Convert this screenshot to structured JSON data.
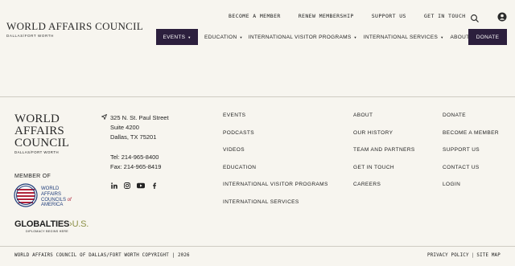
{
  "header": {
    "logo_main": "WORLD AFFAIRS COUNCIL",
    "logo_sub": "DALLAS/FORT WORTH",
    "top_links": [
      "BECOME A MEMBER",
      "RENEW MEMBERSHIP",
      "SUPPORT US",
      "GET IN TOUCH"
    ],
    "search_icon": "search-icon",
    "user_icon": "user-icon",
    "main_nav": {
      "events": "EVENTS",
      "education": "EDUCATION",
      "ivp": "INTERNATIONAL VISITOR PROGRAMS",
      "services": "INTERNATIONAL SERVICES",
      "about": "ABOUT",
      "donate": "DONATE"
    },
    "accent_color": "#2c1f3d"
  },
  "footer": {
    "logo_lines": [
      "WORLD",
      "AFFAIRS",
      "COUNCIL"
    ],
    "logo_sub": "DALLAS/FORT WORTH",
    "member_of": "MEMBER OF",
    "wacca_lines": [
      "WORLD",
      "AFFAIRS",
      "COUNCILS",
      "of",
      "AMERICA"
    ],
    "globalties": {
      "global": "GLOBAL",
      "ties": "TIES",
      "us": "U.S.",
      "tagline": "DIPLOMACY BEGINS HERE"
    },
    "contact": {
      "address_lines": [
        "325 N. St. Paul Street",
        "Suite 4200",
        "Dallas, TX 75201"
      ],
      "tel": "Tel: 214-965-8400",
      "fax": "Fax: 214-965-8419"
    },
    "socials": [
      "linkedin-icon",
      "instagram-icon",
      "youtube-icon",
      "facebook-icon"
    ],
    "col1": [
      "EVENTS",
      "PODCASTS",
      "VIDEOS",
      "EDUCATION",
      "INTERNATIONAL VISITOR PROGRAMS",
      "INTERNATIONAL SERVICES"
    ],
    "col2": [
      "ABOUT",
      "OUR HISTORY",
      "TEAM AND PARTNERS",
      "GET IN TOUCH",
      "CAREERS"
    ],
    "col3": [
      "DONATE",
      "BECOME A MEMBER",
      "SUPPORT US",
      "CONTACT US",
      "LOGIN"
    ],
    "copyright": "WORLD AFFAIRS COUNCIL OF DALLAS/FORT WORTH COPYRIGHT | 2026",
    "legal": {
      "privacy": "PRIVACY POLICY",
      "sitemap": "SITE MAP",
      "separator": "|"
    }
  }
}
